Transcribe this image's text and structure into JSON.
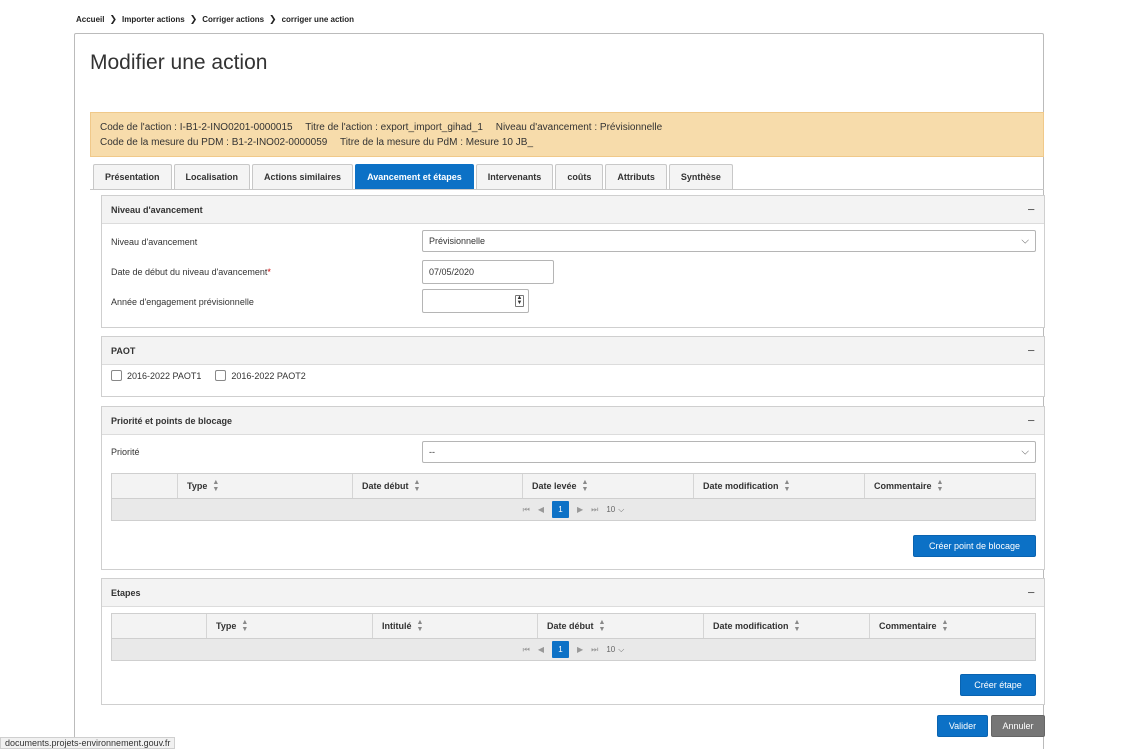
{
  "breadcrumb": [
    "Accueil",
    "Importer actions",
    "Corriger actions",
    "corriger une action"
  ],
  "page_title": "Modifier une action",
  "info": {
    "line1": [
      "Code de l'action : I-B1-2-INO0201-0000015",
      "Titre de l'action : export_import_gihad_1",
      "Niveau d'avancement : Prévisionnelle"
    ],
    "line2": [
      "Code de la mesure du PDM : B1-2-INO02-0000059",
      "Titre de la mesure du PdM : Mesure 10 JB_"
    ]
  },
  "tabs": [
    "Présentation",
    "Localisation",
    "Actions similaires",
    "Avancement et étapes",
    "Intervenants",
    "coûts",
    "Attributs",
    "Synthèse"
  ],
  "active_tab": "Avancement et étapes",
  "niveau": {
    "title": "Niveau d'avancement",
    "label_niveau": "Niveau d'avancement",
    "value_niveau": "Prévisionnelle",
    "label_date": "Date de début du niveau d'avancement",
    "required_mark": "*",
    "value_date": "07/05/2020",
    "label_annee": "Année d'engagement prévisionnelle",
    "value_annee": ""
  },
  "paot": {
    "title": "PAOT",
    "options": [
      "2016-2022 PAOT1",
      "2016-2022 PAOT2"
    ]
  },
  "priorite": {
    "title": "Priorité et points de blocage",
    "label": "Priorité",
    "value": "--",
    "columns": [
      "Type",
      "Date début",
      "Date levée",
      "Date modification",
      "Commentaire"
    ],
    "page": "1",
    "page_size": "10",
    "button": "Créer point de blocage"
  },
  "etapes": {
    "title": "Etapes",
    "columns": [
      "Type",
      "Intitulé",
      "Date début",
      "Date modification",
      "Commentaire"
    ],
    "page": "1",
    "page_size": "10",
    "button": "Créer étape"
  },
  "actions": {
    "validate": "Valider",
    "cancel": "Annuler"
  },
  "status_url": "documents.projets-environnement.gouv.fr",
  "icons": {
    "collapse": "minus-icon",
    "chevron": "chevron-down-icon",
    "sort": "sort-icon",
    "breadcrumb_sep": "chevron-right-icon"
  },
  "colors": {
    "accent": "#0c71c6",
    "info_bg": "#f7dcab",
    "cancel": "#767676"
  }
}
